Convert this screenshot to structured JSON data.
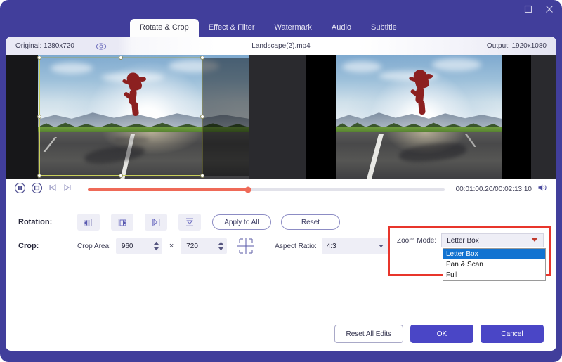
{
  "window": {
    "maximize_label": "maximize",
    "close_label": "close",
    "accent": "#413e9b"
  },
  "tabs": [
    {
      "label": "Rotate & Crop",
      "active": true
    },
    {
      "label": "Effect & Filter",
      "active": false
    },
    {
      "label": "Watermark",
      "active": false
    },
    {
      "label": "Audio",
      "active": false
    },
    {
      "label": "Subtitle",
      "active": false
    }
  ],
  "info": {
    "original": "Original: 1280x720",
    "eye_icon": "eye-icon",
    "filename": "Landscape(2).mp4",
    "output": "Output: 1920x1080"
  },
  "player": {
    "pause_icon": "pause-circle-icon",
    "stop_icon": "stop-circle-icon",
    "prev_icon": "previous-frame-icon",
    "next_icon": "next-frame-icon",
    "progress_percent": 45,
    "timecode": "00:01:00.20/00:02:13.10",
    "volume_icon": "speaker-icon"
  },
  "rotation": {
    "label": "Rotation:",
    "buttons": [
      {
        "icon": "rotate-left-icon"
      },
      {
        "icon": "rotate-right-icon"
      },
      {
        "icon": "flip-horizontal-icon"
      },
      {
        "icon": "flip-vertical-icon"
      }
    ],
    "apply_to_all": "Apply to All",
    "reset": "Reset"
  },
  "crop": {
    "label": "Crop:",
    "area_label": "Crop Area:",
    "width": "960",
    "height": "720",
    "times": "×",
    "center_icon": "crop-center-icon",
    "aspect_label": "Aspect Ratio:",
    "aspect_value": "4:3"
  },
  "zoom_mode": {
    "label": "Zoom Mode:",
    "value": "Letter Box",
    "options": [
      {
        "label": "Letter Box",
        "selected": true
      },
      {
        "label": "Pan & Scan",
        "selected": false
      },
      {
        "label": "Full",
        "selected": false
      }
    ],
    "highlight_color": "#e8352b"
  },
  "footer": {
    "reset_all": "Reset All Edits",
    "ok": "OK",
    "cancel": "Cancel"
  }
}
